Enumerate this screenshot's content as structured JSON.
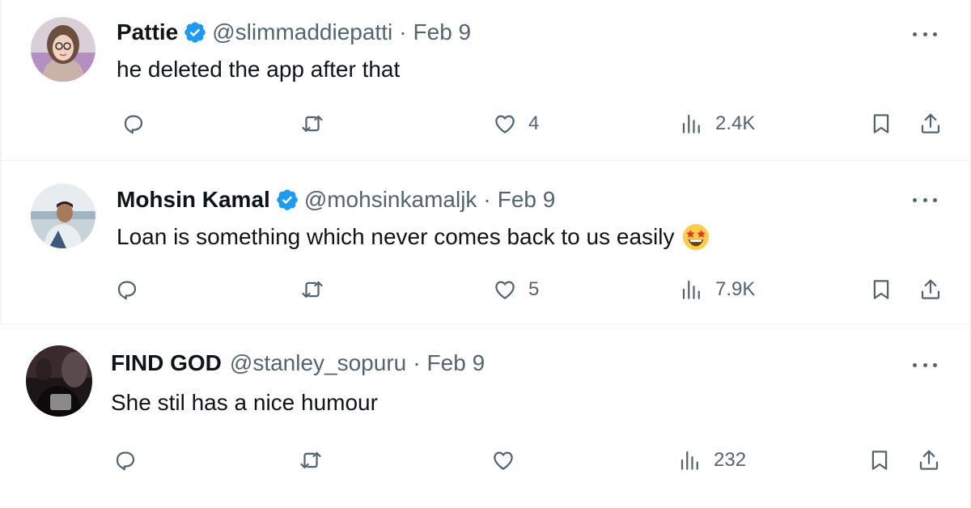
{
  "tweets": [
    {
      "name": "Pattie",
      "verified": true,
      "handle": "@slimmaddiepatti",
      "separator": "·",
      "date": "Feb 9",
      "text": "he deleted the app after that",
      "emoji": null,
      "likes": "4",
      "views": "2.4K"
    },
    {
      "name": "Mohsin Kamal",
      "verified": true,
      "handle": "@mohsinkamaljk",
      "separator": "·",
      "date": "Feb 9",
      "text": "Loan is something which never comes back to us easily",
      "emoji": "star-struck-emoji",
      "likes": "5",
      "views": "7.9K"
    },
    {
      "name": "FIND GOD",
      "verified": false,
      "handle": "@stanley_sopuru",
      "separator": "·",
      "date": "Feb 9",
      "text": "She stil has a nice humour",
      "emoji": null,
      "likes": "",
      "views": "232"
    }
  ],
  "icons": {
    "verified_color": "#1d9bf0",
    "secondary_text_color": "#536471",
    "more": "more-dots-icon",
    "reply": "reply-icon",
    "retweet": "retweet-icon",
    "like": "heart-icon",
    "views": "views-chart-icon",
    "bookmark": "bookmark-icon",
    "share": "share-icon"
  }
}
